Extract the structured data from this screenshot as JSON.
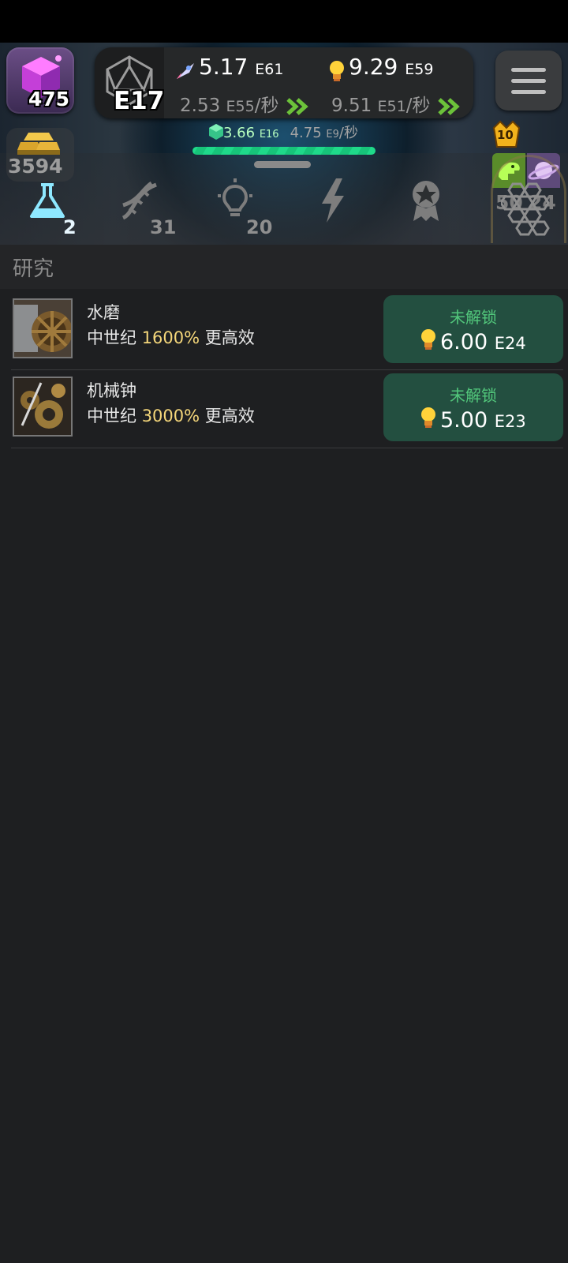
{
  "header": {
    "crystal_count": "475",
    "gold_count": "3594",
    "era": "E17",
    "resource1": {
      "mantissa": "5.17",
      "exp": "E61",
      "rate_mantissa": "2.53",
      "rate_exp": "E55",
      "rate_suffix": "/秒",
      "icon": "rocket-icon"
    },
    "resource2": {
      "mantissa": "9.29",
      "exp": "E59",
      "rate_mantissa": "9.51",
      "rate_exp": "E51",
      "rate_suffix": "/秒",
      "icon": "lightbulb-icon"
    },
    "gem": {
      "mantissa": "3.66",
      "exp": "E16",
      "rate_mantissa": "4.75",
      "rate_exp": "E9",
      "rate_suffix": "/秒",
      "icon": "green-gem-icon"
    },
    "progress_fraction": 1.0,
    "badge_level": "10",
    "dino_count": "50",
    "planet_count": "24"
  },
  "tabs": [
    {
      "name": "research",
      "icon": "flask-icon",
      "count": "2",
      "active": true
    },
    {
      "name": "dna",
      "icon": "dna-icon",
      "count": "31",
      "active": false
    },
    {
      "name": "ideas",
      "icon": "lightbulb-icon",
      "count": "20",
      "active": false
    },
    {
      "name": "power",
      "icon": "lightning-icon",
      "count": "",
      "active": false
    },
    {
      "name": "awards",
      "icon": "award-ribbon-icon",
      "count": "",
      "active": false
    },
    {
      "name": "hive",
      "icon": "hexagon-hive-icon",
      "count": "",
      "active": false
    }
  ],
  "section": {
    "title": "研究"
  },
  "research_items": [
    {
      "name": "水磨",
      "era": "中世纪",
      "percent": "1600%",
      "suffix": "更高效",
      "status": "未解锁",
      "cost_mantissa": "6.00",
      "cost_exp": "E24"
    },
    {
      "name": "机械钟",
      "era": "中世纪",
      "percent": "3000%",
      "suffix": "更高效",
      "status": "未解锁",
      "cost_mantissa": "5.00",
      "cost_exp": "E23"
    }
  ],
  "colors": {
    "background": "#1e1f21",
    "accent_green": "#52c77b",
    "button_bg": "#234f40",
    "highlight_yellow": "#f4d67a",
    "progress": "#1fd98a"
  }
}
